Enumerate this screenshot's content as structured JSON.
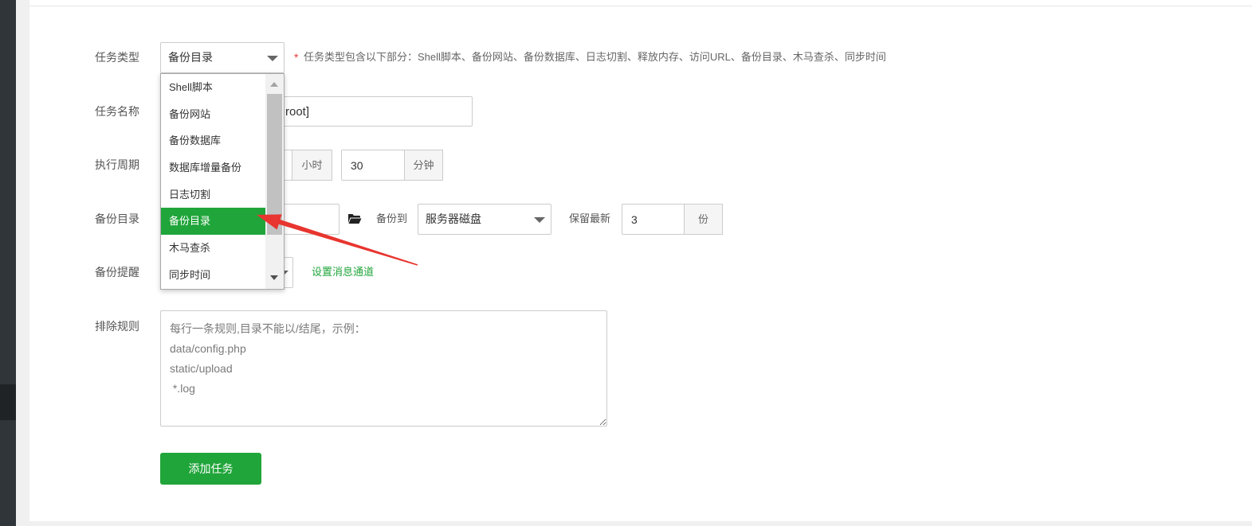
{
  "colors": {
    "accent": "#20a53a",
    "required_mark": "#e53935",
    "annotation_arrow": "#e8352f",
    "sidebar": "#30353a"
  },
  "task_type": {
    "label": "任务类型",
    "selected": "备份目录",
    "required_mark": "*",
    "hint": "任务类型包含以下部分：Shell脚本、备份网站、备份数据库、日志切割、释放内存、访问URL、备份目录、木马查杀、同步时间",
    "icon": "caret-down-icon",
    "options": [
      "Shell脚本",
      "备份网站",
      "备份数据库",
      "数据库增量备份",
      "日志切割",
      "备份目录",
      "木马查杀",
      "同步时间"
    ],
    "highlighted_option": "备份目录"
  },
  "task_name": {
    "label": "任务名称",
    "visible_value": "root]"
  },
  "schedule": {
    "label": "执行周期",
    "hour_unit": "小时",
    "minute_value": "30",
    "minute_unit": "分钟"
  },
  "backup_dir": {
    "label": "备份目录",
    "folder_icon": "folder-open-icon",
    "backup_to_label": "备份到",
    "backup_to_value": "服务器磁盘",
    "keep_label": "保留最新",
    "keep_value": "3",
    "keep_unit": "份"
  },
  "notify": {
    "label": "备份提醒",
    "channel_link": "设置消息通道"
  },
  "exclude": {
    "label": "排除规则",
    "placeholder": "每行一条规则,目录不能以/结尾，示例：\ndata/config.php\nstatic/upload\n *.log"
  },
  "submit": {
    "label": "添加任务"
  }
}
